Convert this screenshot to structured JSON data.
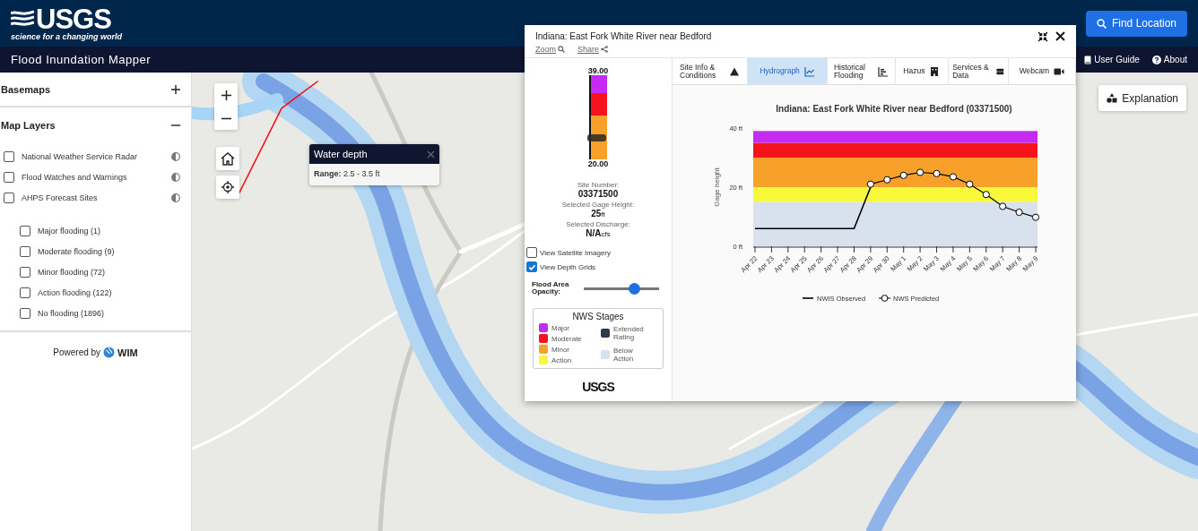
{
  "header": {
    "logo_text": "USGS",
    "logo_tagline": "science for a changing world",
    "find_button": "Find Location"
  },
  "navbar": {
    "title": "Flood Inundation Mapper",
    "links": [
      {
        "label": "User Guide",
        "kind": "guide"
      },
      {
        "label": "About",
        "kind": "about"
      }
    ]
  },
  "sidebar": {
    "sections": [
      {
        "title": "Basemaps",
        "expanded": false
      },
      {
        "title": "Map Layers",
        "expanded": true
      }
    ],
    "layers": [
      {
        "label": "National Weather Service Radar",
        "checked": false
      },
      {
        "label": "Flood Watches and Warnings",
        "checked": false
      },
      {
        "label": "AHPS Forecast Sites",
        "checked": false,
        "children": [
          {
            "label": "Major flooding (1)",
            "checked": false
          },
          {
            "label": "Moderate flooding (9)",
            "checked": false
          },
          {
            "label": "Minor flooding (72)",
            "checked": false
          },
          {
            "label": "Action flooding (122)",
            "checked": false
          },
          {
            "label": "No flooding (1896)",
            "checked": false
          }
        ]
      }
    ],
    "powered_by": "Powered by",
    "brand": "WIM"
  },
  "map_popup": {
    "title": "Water depth",
    "body": "**Range:** 2.5 - 3.5 ft"
  },
  "explanation_button": "Explanation",
  "site_panel": {
    "title": "Indiana: East Fork White River near Bedford",
    "links": [
      "Zoom",
      "Share"
    ],
    "gauge": {
      "max": "39.00",
      "min": "20.00",
      "level": 0.26,
      "bands": [
        {
          "color": "#c52bf2"
        },
        {
          "color": "#f5141e"
        },
        {
          "color": "#f8a12a"
        }
      ]
    },
    "info": [
      {
        "label": "Site Number:",
        "value": "03371500"
      },
      {
        "label": "Selected Gage Height:",
        "value": "25",
        "unit": "ft"
      },
      {
        "label": "Selected Discharge:",
        "value": "N/A",
        "unit": "cfs"
      }
    ],
    "options": [
      {
        "label": "View Satellite Imagery",
        "checked": false
      },
      {
        "label": "View Depth Grids",
        "checked": true
      }
    ],
    "opacity": {
      "label": "Flood Area Opacity:",
      "level": 0.67
    },
    "legend": {
      "title": "NWS Stages",
      "items": [
        {
          "label": "Major",
          "color": "#c52bf2"
        },
        {
          "label": "Moderate",
          "color": "#f5141e"
        },
        {
          "label": "Minor",
          "color": "#f8a12a"
        },
        {
          "label": "Action",
          "color": "#f8f83c"
        },
        {
          "label": "Extended Rating",
          "color": "#2e3a50"
        },
        {
          "label": "Below Action",
          "color": "#d8e1ee"
        }
      ]
    },
    "footer_logo": "USGS",
    "tabs": [
      {
        "label": "Site Info & Conditions",
        "kind": "triangle",
        "selected": false
      },
      {
        "label": "Hydrograph",
        "kind": "chart",
        "selected": true
      },
      {
        "label": "Historical Flooding",
        "kind": "bars",
        "selected": false
      },
      {
        "label": "Hazus",
        "kind": "building",
        "selected": false
      },
      {
        "label": "Services & Data",
        "kind": "server",
        "selected": false
      },
      {
        "label": "Webcam",
        "kind": "camera",
        "selected": false
      }
    ],
    "chart_data": {
      "type": "line",
      "title": "Indiana: East Fork White River near Bedford (03371500)",
      "ylabel": "Gage height",
      "categories": [
        "Apr 22",
        "Apr 23",
        "Apr 24",
        "Apr 25",
        "Apr 26",
        "Apr 27",
        "Apr 28",
        "Apr 29",
        "Apr 30",
        "May 1",
        "May 2",
        "May 3",
        "May 4",
        "May 5",
        "May 6",
        "May 7",
        "May 8",
        "May 9"
      ],
      "ylim": [
        0,
        40
      ],
      "yticks": [
        {
          "value": 0,
          "label": "0 ft"
        },
        {
          "value": 20,
          "label": "20 ft"
        },
        {
          "value": 40,
          "label": "40 ft"
        }
      ],
      "series": [
        {
          "name": "NWIS Observed",
          "color": "#000000",
          "values": [
            6,
            6,
            6,
            6,
            6,
            6,
            6,
            20,
            null,
            null,
            null,
            null,
            null,
            null,
            null,
            null,
            null,
            null
          ]
        },
        {
          "name": "NWS Predicted",
          "color": "#000000",
          "marker": "circle",
          "values": [
            null,
            null,
            null,
            null,
            null,
            null,
            null,
            21,
            22.5,
            24,
            25,
            24.6,
            23.5,
            21,
            17.5,
            13.5,
            11.5,
            9.8
          ]
        }
      ],
      "legend": "bottom",
      "bands": [
        {
          "axis": "y",
          "from": 0,
          "to": 15,
          "color": "#d8e1ee"
        },
        {
          "axis": "y",
          "from": 15,
          "to": 20,
          "color": "#f8f83c"
        },
        {
          "axis": "y",
          "from": 20,
          "to": 30,
          "color": "#f8a12a"
        },
        {
          "axis": "y",
          "from": 30,
          "to": 35,
          "color": "#f5141e"
        },
        {
          "axis": "y",
          "from": 35,
          "to": 39,
          "color": "#c52bf2"
        }
      ]
    }
  }
}
